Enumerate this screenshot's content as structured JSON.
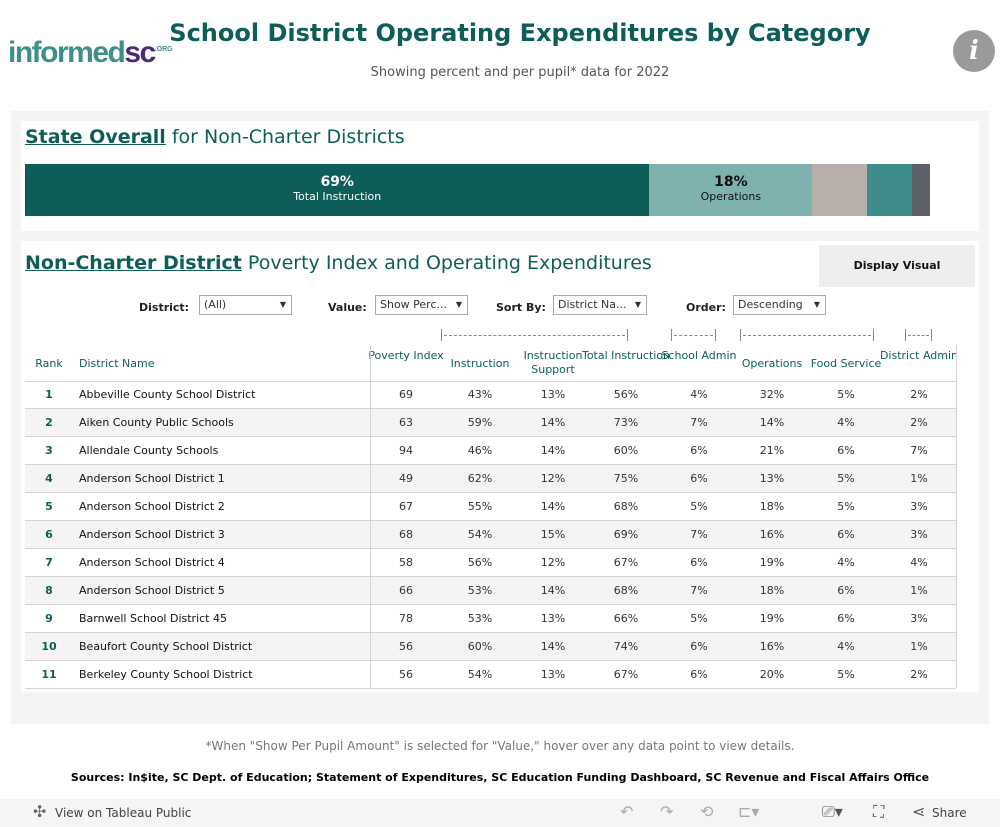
{
  "header": {
    "logo_main": "informed",
    "logo_accent": "sc",
    "logo_suffix": ".ORG",
    "title": "School District Operating Expenditures by Category",
    "subtitle": "Showing percent and per pupil* data for 2022",
    "info_icon": "i"
  },
  "state": {
    "heading_bold": "State Overall",
    "heading_rest": " for Non-Charter Districts",
    "chart_data": {
      "type": "bar",
      "orientation": "horizontal-stacked",
      "unit": "%",
      "segments": [
        {
          "value": 69,
          "value_label": "69%",
          "label": "Total Instruction",
          "color": "#0d5e58"
        },
        {
          "value": 18,
          "value_label": "18%",
          "label": "Operations",
          "color": "#7fb2af"
        },
        {
          "value": 6,
          "color": "#b9afaa"
        },
        {
          "value": 5,
          "color": "#3f8d8b"
        },
        {
          "value": 2,
          "color": "#5d5f69"
        }
      ]
    }
  },
  "district": {
    "heading_bold": "Non-Charter District",
    "heading_rest": " Poverty Index and Operating Expenditures",
    "display_button": "Display Visual",
    "filters": [
      {
        "label": "District:",
        "value": "(All)"
      },
      {
        "label": "Value:",
        "value": "Show Perc..."
      },
      {
        "label": "Sort By:",
        "value": "District Na..."
      },
      {
        "label": "Order:",
        "value": "Descending"
      }
    ],
    "columns": [
      "Rank",
      "District Name",
      "Poverty Index",
      "Instruction",
      "Instruction Support",
      "Total Instruction",
      "School Admin",
      "Operations",
      "Food Service",
      "District Admin"
    ],
    "rows": [
      [
        "1",
        "Abbeville County School District",
        "69",
        "43%",
        "13%",
        "56%",
        "4%",
        "32%",
        "5%",
        "2%"
      ],
      [
        "2",
        "Aiken County Public Schools",
        "63",
        "59%",
        "14%",
        "73%",
        "7%",
        "14%",
        "4%",
        "2%"
      ],
      [
        "3",
        "Allendale County Schools",
        "94",
        "46%",
        "14%",
        "60%",
        "6%",
        "21%",
        "6%",
        "7%"
      ],
      [
        "4",
        "Anderson School District 1",
        "49",
        "62%",
        "12%",
        "75%",
        "6%",
        "13%",
        "5%",
        "1%"
      ],
      [
        "5",
        "Anderson School District 2",
        "67",
        "55%",
        "14%",
        "68%",
        "5%",
        "18%",
        "5%",
        "3%"
      ],
      [
        "6",
        "Anderson School District 3",
        "68",
        "54%",
        "15%",
        "69%",
        "7%",
        "16%",
        "6%",
        "3%"
      ],
      [
        "7",
        "Anderson School District 4",
        "58",
        "56%",
        "12%",
        "67%",
        "6%",
        "19%",
        "4%",
        "4%"
      ],
      [
        "8",
        "Anderson School District 5",
        "66",
        "53%",
        "14%",
        "68%",
        "7%",
        "18%",
        "6%",
        "1%"
      ],
      [
        "9",
        "Barnwell School District 45",
        "78",
        "53%",
        "13%",
        "66%",
        "5%",
        "19%",
        "6%",
        "3%"
      ],
      [
        "10",
        "Beaufort County School District",
        "56",
        "60%",
        "14%",
        "74%",
        "6%",
        "16%",
        "4%",
        "1%"
      ],
      [
        "11",
        "Berkeley County School District",
        "56",
        "54%",
        "13%",
        "67%",
        "6%",
        "20%",
        "5%",
        "2%"
      ]
    ]
  },
  "footer": {
    "note": "*When \"Show Per Pupil Amount\" is selected for \"Value,\" hover over any data point to view details.",
    "sources": "Sources:  In$ite, SC Dept. of Education; Statement of Expenditures, SC Education Funding Dashboard, SC Revenue and Fiscal Affairs Office"
  },
  "toolbar": {
    "view_label": "View on Tableau Public",
    "share_label": "Share"
  }
}
